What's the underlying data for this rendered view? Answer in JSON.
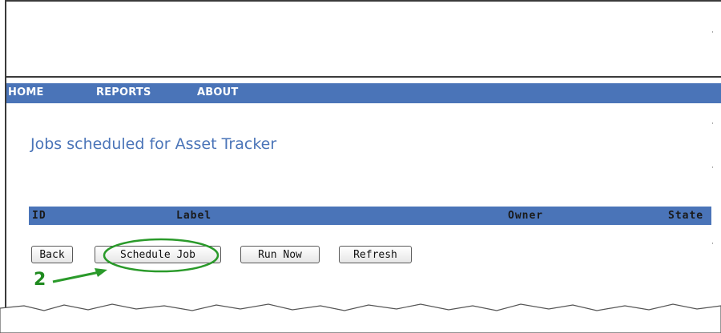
{
  "nav": {
    "items": [
      {
        "label": "HOME"
      },
      {
        "label": "REPORTS"
      },
      {
        "label": "ABOUT"
      }
    ]
  },
  "page": {
    "title": "Jobs scheduled for Asset Tracker"
  },
  "table": {
    "columns": [
      "ID",
      "Label",
      "Owner",
      "State"
    ]
  },
  "buttons": {
    "back": "Back",
    "schedule_job": "Schedule Job",
    "run_now": "Run Now",
    "refresh": "Refresh"
  },
  "annotation": {
    "step_number": "2",
    "color": "#2a9a2a"
  },
  "colors": {
    "nav_bg": "#4a74b8",
    "title": "#4a74b8"
  }
}
